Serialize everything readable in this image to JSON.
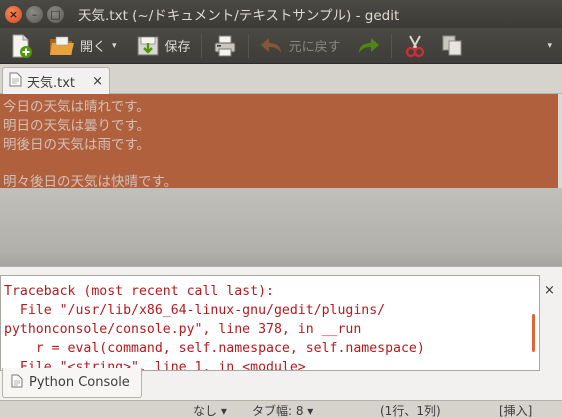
{
  "window": {
    "title": "天気.txt (~/ドキュメント/テキストサンプル) - gedit",
    "close_glyph": "×",
    "minimize_glyph": "–",
    "maximize_glyph": "□"
  },
  "toolbar": {
    "new_icon": "new-document-icon",
    "open_label": "開く",
    "open_icon": "folder-icon",
    "save_label": "保存",
    "save_icon": "save-icon",
    "print_icon": "printer-icon",
    "undo_label": "元に戻す",
    "undo_icon": "undo-arrow-icon",
    "redo_icon": "redo-arrow-icon",
    "cut_icon": "scissors-icon",
    "copy_icon": "copy-icon",
    "dropdown_glyph": "▾"
  },
  "tabs": [
    {
      "label": "天気.txt",
      "close_glyph": "×"
    }
  ],
  "editor": {
    "lines": [
      "今日の天気は晴れです。",
      "明日の天気は曇りです。",
      "明後日の天気は雨です。",
      "",
      "明々後日の天気は快晴です。"
    ],
    "selection_color": "#c8582b"
  },
  "console": {
    "lines": [
      "Traceback (most recent call last):",
      "  File \"/usr/lib/x86_64-linux-gnu/gedit/plugins/",
      "pythonconsole/console.py\", line 378, in __run",
      "    r = eval(command, self.namespace, self.namespace)",
      "  File \"<string>\", line 1, in <module>"
    ],
    "error_color": "#b8181d",
    "close_glyph": "×",
    "tab_label": "Python Console"
  },
  "statusbar": {
    "language": "なし ▾",
    "tab_width": "タブ幅: 8 ▾",
    "position": "(1行、1列)",
    "mode": "[挿入]"
  },
  "colors": {
    "accent": "#dd4814",
    "titlebar_bg": "#3c3b37"
  }
}
